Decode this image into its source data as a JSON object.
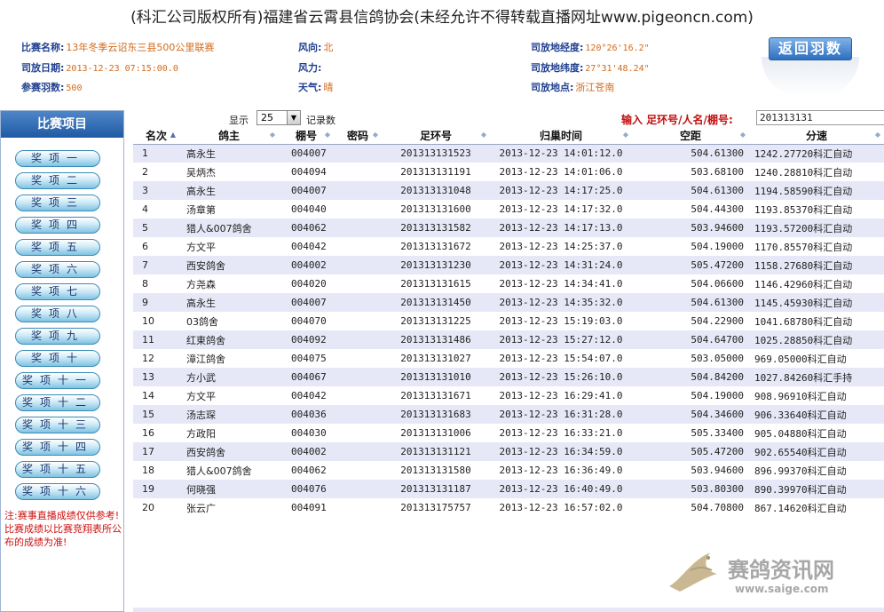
{
  "banner": "(科汇公司版权所有)福建省云霄县信鸽协会(未经允许不得转载直播网址www.pigeoncn.com)",
  "race": {
    "name_label": "比赛名称:",
    "name": "13年冬季云诏东三县500公里联赛",
    "release_date_label": "司放日期:",
    "release_date": "2013-12-23 07:15:00.0",
    "entries_label": "参赛羽数:",
    "entries": "500",
    "wind_dir_label": "风向:",
    "wind_dir": "北",
    "wind_force_label": "风力:",
    "wind_force": "",
    "weather_label": "天气:",
    "weather": "晴",
    "lon_label": "司放地经度:",
    "lon": "120°26'16.2\"",
    "lat_label": "司放地纬度:",
    "lat": "27°31'48.24\"",
    "place_label": "司放地点:",
    "place": "浙江苍南"
  },
  "back_button": "返回羽数",
  "sidebar": {
    "title": "比赛项目",
    "items": [
      "奖项一",
      "奖项二",
      "奖项三",
      "奖项四",
      "奖项五",
      "奖项六",
      "奖项七",
      "奖项八",
      "奖项九",
      "奖项十",
      "奖项十一",
      "奖项十二",
      "奖项十三",
      "奖项十四",
      "奖项十五",
      "奖项十六"
    ],
    "note": "注:赛事直播成绩仅供参考!比赛成绩以比赛竞翔表所公布的成绩为准!"
  },
  "controls": {
    "show_label": "显示",
    "page_size": "25",
    "records_label": "记录数",
    "search_label": "输入 足环号/人名/棚号:",
    "search_value": "201313131"
  },
  "table": {
    "headers": [
      "名次",
      "鸽主",
      "棚号",
      "密码",
      "足环号",
      "归巢时间",
      "空距",
      "分速"
    ],
    "rows": [
      [
        "1",
        "高永生",
        "004007",
        "",
        "201313131523",
        "2013-12-23 14:01:12.0",
        "504.61300",
        "1242.27720",
        "科汇自动"
      ],
      [
        "2",
        "吴炳杰",
        "004094",
        "",
        "201313131191",
        "2013-12-23 14:01:06.0",
        "503.68100",
        "1240.28810",
        "科汇自动"
      ],
      [
        "3",
        "高永生",
        "004007",
        "",
        "201313131048",
        "2013-12-23 14:17:25.0",
        "504.61300",
        "1194.58590",
        "科汇自动"
      ],
      [
        "4",
        "汤章第",
        "004040",
        "",
        "201313131600",
        "2013-12-23 14:17:32.0",
        "504.44300",
        "1193.85370",
        "科汇自动"
      ],
      [
        "5",
        "猎人&007鸽舍",
        "004062",
        "",
        "201313131582",
        "2013-12-23 14:17:13.0",
        "503.94600",
        "1193.57200",
        "科汇自动"
      ],
      [
        "6",
        "方文平",
        "004042",
        "",
        "201313131672",
        "2013-12-23 14:25:37.0",
        "504.19000",
        "1170.85570",
        "科汇自动"
      ],
      [
        "7",
        "西安鸽舍",
        "004002",
        "",
        "201313131230",
        "2013-12-23 14:31:24.0",
        "505.47200",
        "1158.27680",
        "科汇自动"
      ],
      [
        "8",
        "方尧森",
        "004020",
        "",
        "201313131615",
        "2013-12-23 14:34:41.0",
        "504.06600",
        "1146.42960",
        "科汇自动"
      ],
      [
        "9",
        "高永生",
        "004007",
        "",
        "201313131450",
        "2013-12-23 14:35:32.0",
        "504.61300",
        "1145.45930",
        "科汇自动"
      ],
      [
        "10",
        "03鸽舍",
        "004070",
        "",
        "201313131225",
        "2013-12-23 15:19:03.0",
        "504.22900",
        "1041.68780",
        "科汇自动"
      ],
      [
        "11",
        "红東鸽舍",
        "004092",
        "",
        "201313131486",
        "2013-12-23 15:27:12.0",
        "504.64700",
        "1025.28850",
        "科汇自动"
      ],
      [
        "12",
        "漳江鸽舍",
        "004075",
        "",
        "201313131027",
        "2013-12-23 15:54:07.0",
        "503.05000",
        "969.05000",
        "科汇自动"
      ],
      [
        "13",
        "方小武",
        "004067",
        "",
        "201313131010",
        "2013-12-23 15:26:10.0",
        "504.84200",
        "1027.84260",
        "科汇手持"
      ],
      [
        "14",
        "方文平",
        "004042",
        "",
        "201313131671",
        "2013-12-23 16:29:41.0",
        "504.19000",
        "908.96910",
        "科汇自动"
      ],
      [
        "15",
        "汤志琛",
        "004036",
        "",
        "201313131683",
        "2013-12-23 16:31:28.0",
        "504.34600",
        "906.33640",
        "科汇自动"
      ],
      [
        "16",
        "方政阳",
        "004030",
        "",
        "201313131006",
        "2013-12-23 16:33:21.0",
        "505.33400",
        "905.04880",
        "科汇自动"
      ],
      [
        "17",
        "西安鸽舍",
        "004002",
        "",
        "201313131121",
        "2013-12-23 16:34:59.0",
        "505.47200",
        "902.65540",
        "科汇自动"
      ],
      [
        "18",
        "猎人&007鸽舍",
        "004062",
        "",
        "201313131580",
        "2013-12-23 16:36:49.0",
        "503.94600",
        "896.99370",
        "科汇自动"
      ],
      [
        "19",
        "何晓强",
        "004076",
        "",
        "201313131187",
        "2013-12-23 16:40:49.0",
        "503.80300",
        "890.39970",
        "科汇自动"
      ],
      [
        "20",
        "张云广",
        "004091",
        "",
        "201313175757",
        "2013-12-23 16:57:02.0",
        "504.70800",
        "867.14620",
        "科汇自动"
      ]
    ]
  },
  "watermark": {
    "text": "赛鸽资讯网",
    "url": "www.saige.com"
  }
}
